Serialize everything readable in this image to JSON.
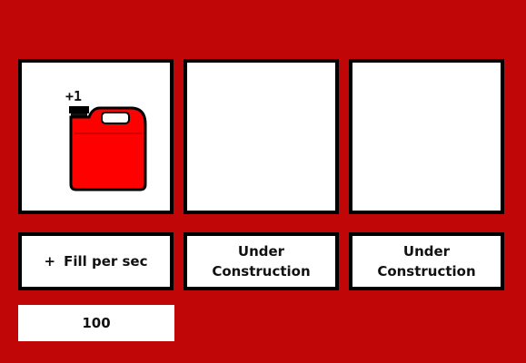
{
  "tiles": [
    {
      "name": "jerry-can",
      "badge": "+1"
    },
    {
      "name": "empty"
    },
    {
      "name": "empty"
    }
  ],
  "buttons": {
    "fill": {
      "prefix": "+",
      "label": "Fill per sec"
    },
    "slot2": {
      "line1": "Under",
      "line2": "Construction"
    },
    "slot3": {
      "line1": "Under",
      "line2": "Construction"
    }
  },
  "counter": {
    "value": "100"
  },
  "colors": {
    "background": "#c00606",
    "can_red": "#ff0000",
    "border": "#000000"
  }
}
